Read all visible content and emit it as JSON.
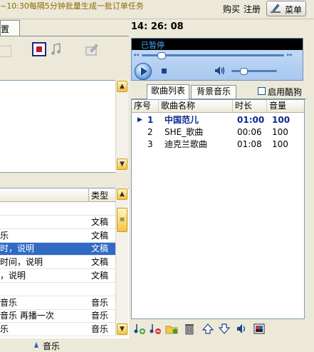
{
  "colors": {
    "accent": "#316ac5",
    "current_song": "#0b2a8f",
    "status_text": "#4aa6ff"
  },
  "header": {
    "notice": "~10:30每隔5分钟批量生成一批订单任务",
    "buy": "购买",
    "register": "注册",
    "menu_label": "菜单",
    "menu_icon": "pen-icon"
  },
  "left": {
    "tab_label": "置",
    "toolbar_icons": [
      "record-icon",
      "music-note-icon",
      "locked-edit-icon"
    ],
    "table": {
      "headers": [
        "",
        "类型"
      ],
      "rows": [
        {
          "name": "",
          "type": ""
        },
        {
          "name": "",
          "type": "文稿"
        },
        {
          "name": "乐",
          "type": "文稿"
        },
        {
          "name": "时，说明",
          "type": "文稿",
          "selected": true
        },
        {
          "name": "时间，说明",
          "type": "文稿"
        },
        {
          "name": "，说明",
          "type": "文稿"
        },
        {
          "name": "",
          "type": ""
        },
        {
          "name": "音乐",
          "type": "音乐"
        },
        {
          "name": "音乐 再播一次",
          "type": "音乐"
        },
        {
          "name": "乐",
          "type": "音乐"
        }
      ]
    },
    "bottom_item": "音乐"
  },
  "player": {
    "clock": "14: 26: 08",
    "status": "已暂停",
    "seek_progress": 0.11,
    "volume_level": 0.18
  },
  "tabs": {
    "songs": "歌曲列表",
    "background": "背景音乐",
    "enable_bg_label": "启用酷狗",
    "enable_bg_checked": false
  },
  "songlist": {
    "headers": [
      "序号",
      "歌曲名称",
      "时长",
      "音量"
    ],
    "rows": [
      {
        "index": "1",
        "name": "中国范儿",
        "duration": "01:00",
        "volume": "100",
        "current": true
      },
      {
        "index": "2",
        "name": "SHE_歌曲",
        "duration": "00:06",
        "volume": "100"
      },
      {
        "index": "3",
        "name": "迪克兰歌曲",
        "duration": "01:08",
        "volume": "100"
      }
    ]
  },
  "bottom_toolbar": [
    "add-song-icon",
    "remove-song-icon",
    "add-folder-icon",
    "delete-icon",
    "move-up-icon",
    "move-down-icon",
    "volume-icon",
    "settings-icon"
  ]
}
